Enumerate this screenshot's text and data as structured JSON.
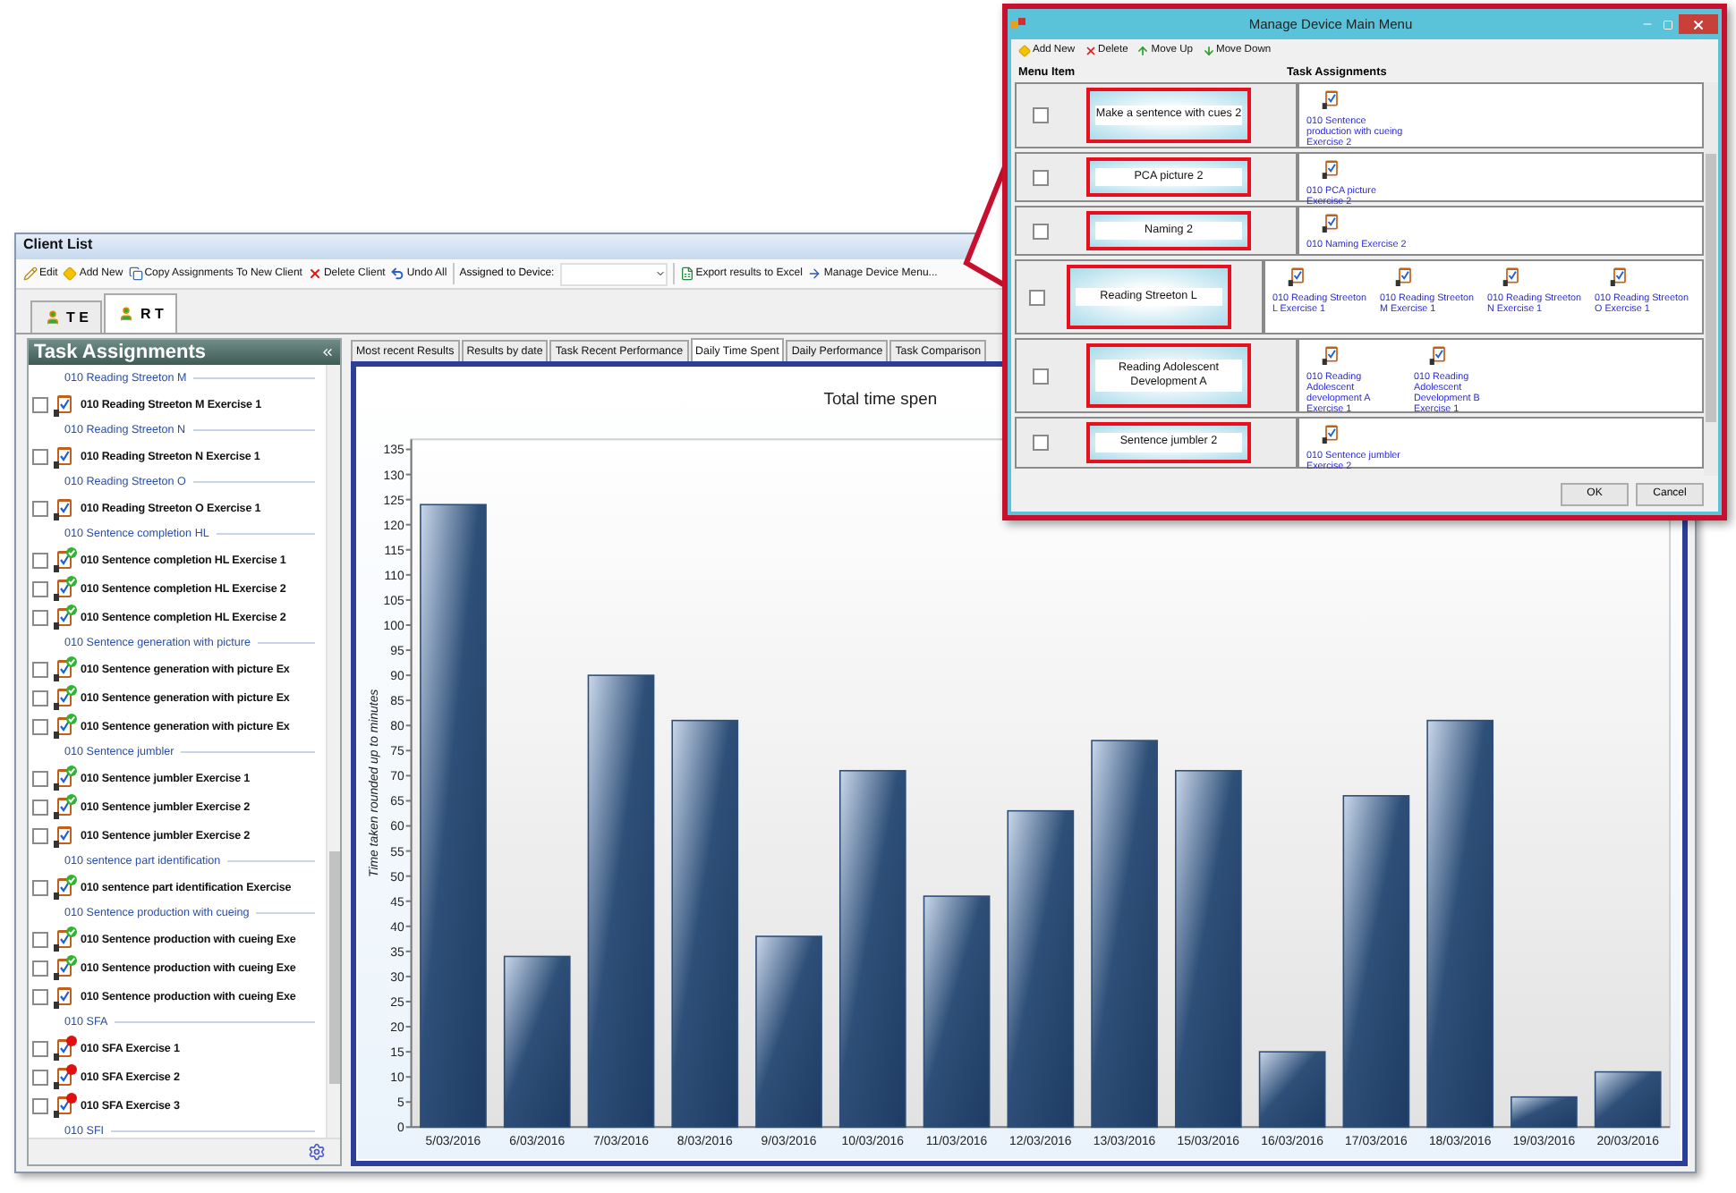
{
  "window": {
    "title": "Client List"
  },
  "toolbar": [
    {
      "kind": "edit",
      "label": "Edit"
    },
    {
      "kind": "add",
      "label": "Add New"
    },
    {
      "kind": "copy",
      "label": "Copy Assignments To New Client"
    },
    {
      "kind": "delete",
      "label": "Delete Client"
    },
    {
      "kind": "undo",
      "label": "Undo All"
    },
    {
      "kind": "device",
      "label": "Assigned to Device:"
    },
    {
      "kind": "export",
      "label": "Export results to Excel"
    },
    {
      "kind": "manage",
      "label": "Manage Device Menu..."
    }
  ],
  "client_tabs": [
    {
      "label": "T E",
      "selected": false
    },
    {
      "label": "R T",
      "selected": true
    }
  ],
  "task_panel": {
    "title": "Task Assignments",
    "rows": [
      {
        "kind": "group",
        "label": "010 Reading Streeton M"
      },
      {
        "kind": "task",
        "label": "010 Reading Streeton M Exercise 1",
        "checked": false,
        "completed": false,
        "flagged": false
      },
      {
        "kind": "group",
        "label": "010 Reading Streeton N"
      },
      {
        "kind": "task",
        "label": "010 Reading Streeton N Exercise 1",
        "checked": false,
        "completed": false,
        "flagged": false
      },
      {
        "kind": "group",
        "label": "010 Reading Streeton O"
      },
      {
        "kind": "task",
        "label": "010 Reading Streeton O Exercise 1",
        "checked": false,
        "completed": false,
        "flagged": false
      },
      {
        "kind": "group",
        "label": "010 Sentence completion HL"
      },
      {
        "kind": "task",
        "label": "010 Sentence completion HL Exercise 1",
        "checked": false,
        "completed": true,
        "flagged": false
      },
      {
        "kind": "task",
        "label": "010 Sentence completion HL Exercise 2",
        "checked": false,
        "completed": true,
        "flagged": false
      },
      {
        "kind": "task",
        "label": "010 Sentence completion HL Exercise 2",
        "checked": false,
        "completed": true,
        "flagged": false
      },
      {
        "kind": "group",
        "label": "010 Sentence generation with picture"
      },
      {
        "kind": "task",
        "label": "010 Sentence generation with picture Ex",
        "checked": false,
        "completed": true,
        "flagged": false
      },
      {
        "kind": "task",
        "label": "010 Sentence generation with picture Ex",
        "checked": false,
        "completed": true,
        "flagged": false
      },
      {
        "kind": "task",
        "label": "010 Sentence generation with picture Ex",
        "checked": false,
        "completed": true,
        "flagged": false
      },
      {
        "kind": "group",
        "label": "010 Sentence jumbler"
      },
      {
        "kind": "task",
        "label": "010 Sentence jumbler Exercise 1",
        "checked": false,
        "completed": true,
        "flagged": false
      },
      {
        "kind": "task",
        "label": "010 Sentence jumbler Exercise 2",
        "checked": false,
        "completed": true,
        "flagged": false
      },
      {
        "kind": "task",
        "label": "010 Sentence jumbler Exercise 2",
        "checked": false,
        "completed": false,
        "flagged": false
      },
      {
        "kind": "group",
        "label": "010 sentence part identification"
      },
      {
        "kind": "task",
        "label": "010 sentence part identification Exercise",
        "checked": false,
        "completed": true,
        "flagged": false
      },
      {
        "kind": "group",
        "label": "010 Sentence production with cueing"
      },
      {
        "kind": "task",
        "label": "010 Sentence production with cueing Exe",
        "checked": false,
        "completed": true,
        "flagged": false
      },
      {
        "kind": "task",
        "label": "010 Sentence production with cueing Exe",
        "checked": false,
        "completed": true,
        "flagged": false
      },
      {
        "kind": "task",
        "label": "010 Sentence production with cueing Exe",
        "checked": false,
        "completed": false,
        "flagged": false
      },
      {
        "kind": "group",
        "label": "010 SFA"
      },
      {
        "kind": "task",
        "label": "010 SFA  Exercise 1",
        "checked": false,
        "completed": false,
        "flagged": true
      },
      {
        "kind": "task",
        "label": "010 SFA  Exercise 2",
        "checked": false,
        "completed": false,
        "flagged": true
      },
      {
        "kind": "task",
        "label": "010 SFA  Exercise 3",
        "checked": false,
        "completed": false,
        "flagged": true
      },
      {
        "kind": "group",
        "label": "010 SFI"
      }
    ]
  },
  "result_tabs": [
    {
      "label": "Most recent Results",
      "selected": false
    },
    {
      "label": "Results by date",
      "selected": false
    },
    {
      "label": "Task Recent Performance",
      "selected": false
    },
    {
      "label": "Daily Time Spent",
      "selected": true
    },
    {
      "label": "Daily Performance",
      "selected": false
    },
    {
      "label": "Task Comparison",
      "selected": false
    }
  ],
  "chart": {
    "chart_data": {
      "type": "bar",
      "title": "Total time spen",
      "ylabel": "Time taken rounded up to minutes",
      "categories": [
        "5/03/2016",
        "6/03/2016",
        "7/03/2016",
        "8/03/2016",
        "9/03/2016",
        "10/03/2016",
        "11/03/2016",
        "12/03/2016",
        "13/03/2016",
        "15/03/2016",
        "16/03/2016",
        "17/03/2016",
        "18/03/2016",
        "19/03/2016",
        "20/03/2016"
      ],
      "series": [
        {
          "color": "#2e4f78",
          "values": [
            124,
            34,
            90,
            81,
            38,
            71,
            46,
            63,
            77,
            71,
            15,
            66,
            81,
            6,
            11
          ]
        }
      ],
      "ylim": [
        0,
        137
      ],
      "yticks": [
        0,
        5,
        10,
        15,
        20,
        25,
        30,
        35,
        40,
        45,
        50,
        55,
        60,
        65,
        70,
        75,
        80,
        85,
        90,
        95,
        100,
        105,
        110,
        115,
        120,
        125,
        130,
        135
      ]
    }
  },
  "device_menu_dialog": {
    "title": "Manage Device Main Menu",
    "toolbar": [
      {
        "kind": "add",
        "label": "Add New"
      },
      {
        "kind": "delete",
        "label": "Delete"
      },
      {
        "kind": "up",
        "label": "Move Up"
      },
      {
        "kind": "down",
        "label": "Move Down"
      }
    ],
    "columns": [
      "Menu Item",
      "Task Assignments"
    ],
    "rows": [
      {
        "checked": false,
        "menu_item": "Make a sentence with cues 2",
        "tasks": [
          "010 Sentence production with cueing Exercise 2"
        ]
      },
      {
        "checked": false,
        "menu_item": "PCA picture 2",
        "tasks": [
          "010 PCA picture Exercise 2"
        ]
      },
      {
        "checked": false,
        "menu_item": "Naming  2",
        "tasks": [
          "010 Naming Exercise 2"
        ]
      },
      {
        "checked": false,
        "menu_item": "Reading Streeton L",
        "tasks": [
          "010 Reading Streeton L Exercise 1",
          "010 Reading Streeton M Exercise 1",
          "010 Reading Streeton N Exercise 1",
          "010 Reading Streeton O Exercise 1"
        ]
      },
      {
        "checked": false,
        "menu_item": "Reading Adolescent Development A",
        "tasks": [
          "010 Reading Adolescent development A Exercise 1",
          "010 Reading Adolescent Development B Exercise 1"
        ]
      },
      {
        "checked": false,
        "menu_item": "Sentence jumbler  2",
        "tasks": [
          "010 Sentence jumbler Exercise 2"
        ]
      }
    ],
    "buttons": [
      "OK",
      "Cancel"
    ]
  }
}
